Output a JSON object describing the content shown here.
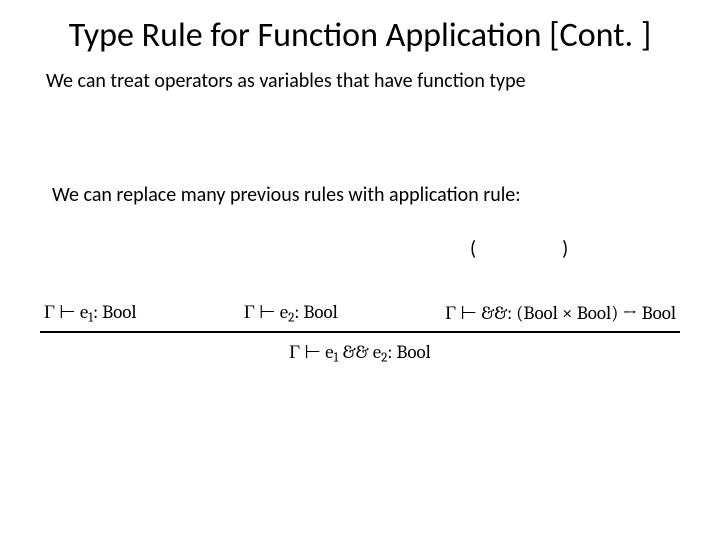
{
  "title": "Type Rule for Function Application [Cont. ]",
  "body1": "We can treat operators as variables that have function type",
  "body2": "We can replace many previous rules with application rule:",
  "parens": {
    "open": "(",
    "close": ")"
  },
  "rule": {
    "premise1_html": "Γ ⊢ e<span class=\"sub\">1</span>: Bool",
    "premise2_html": "Γ ⊢ e<span class=\"sub\">2</span>: Bool",
    "premise3_html": "Γ ⊢ &&: (Bool × Bool) → Bool",
    "conclusion_html": "Γ ⊢ e<span class=\"sub\">1</span> && e<span class=\"sub\">2</span>: Bool"
  }
}
